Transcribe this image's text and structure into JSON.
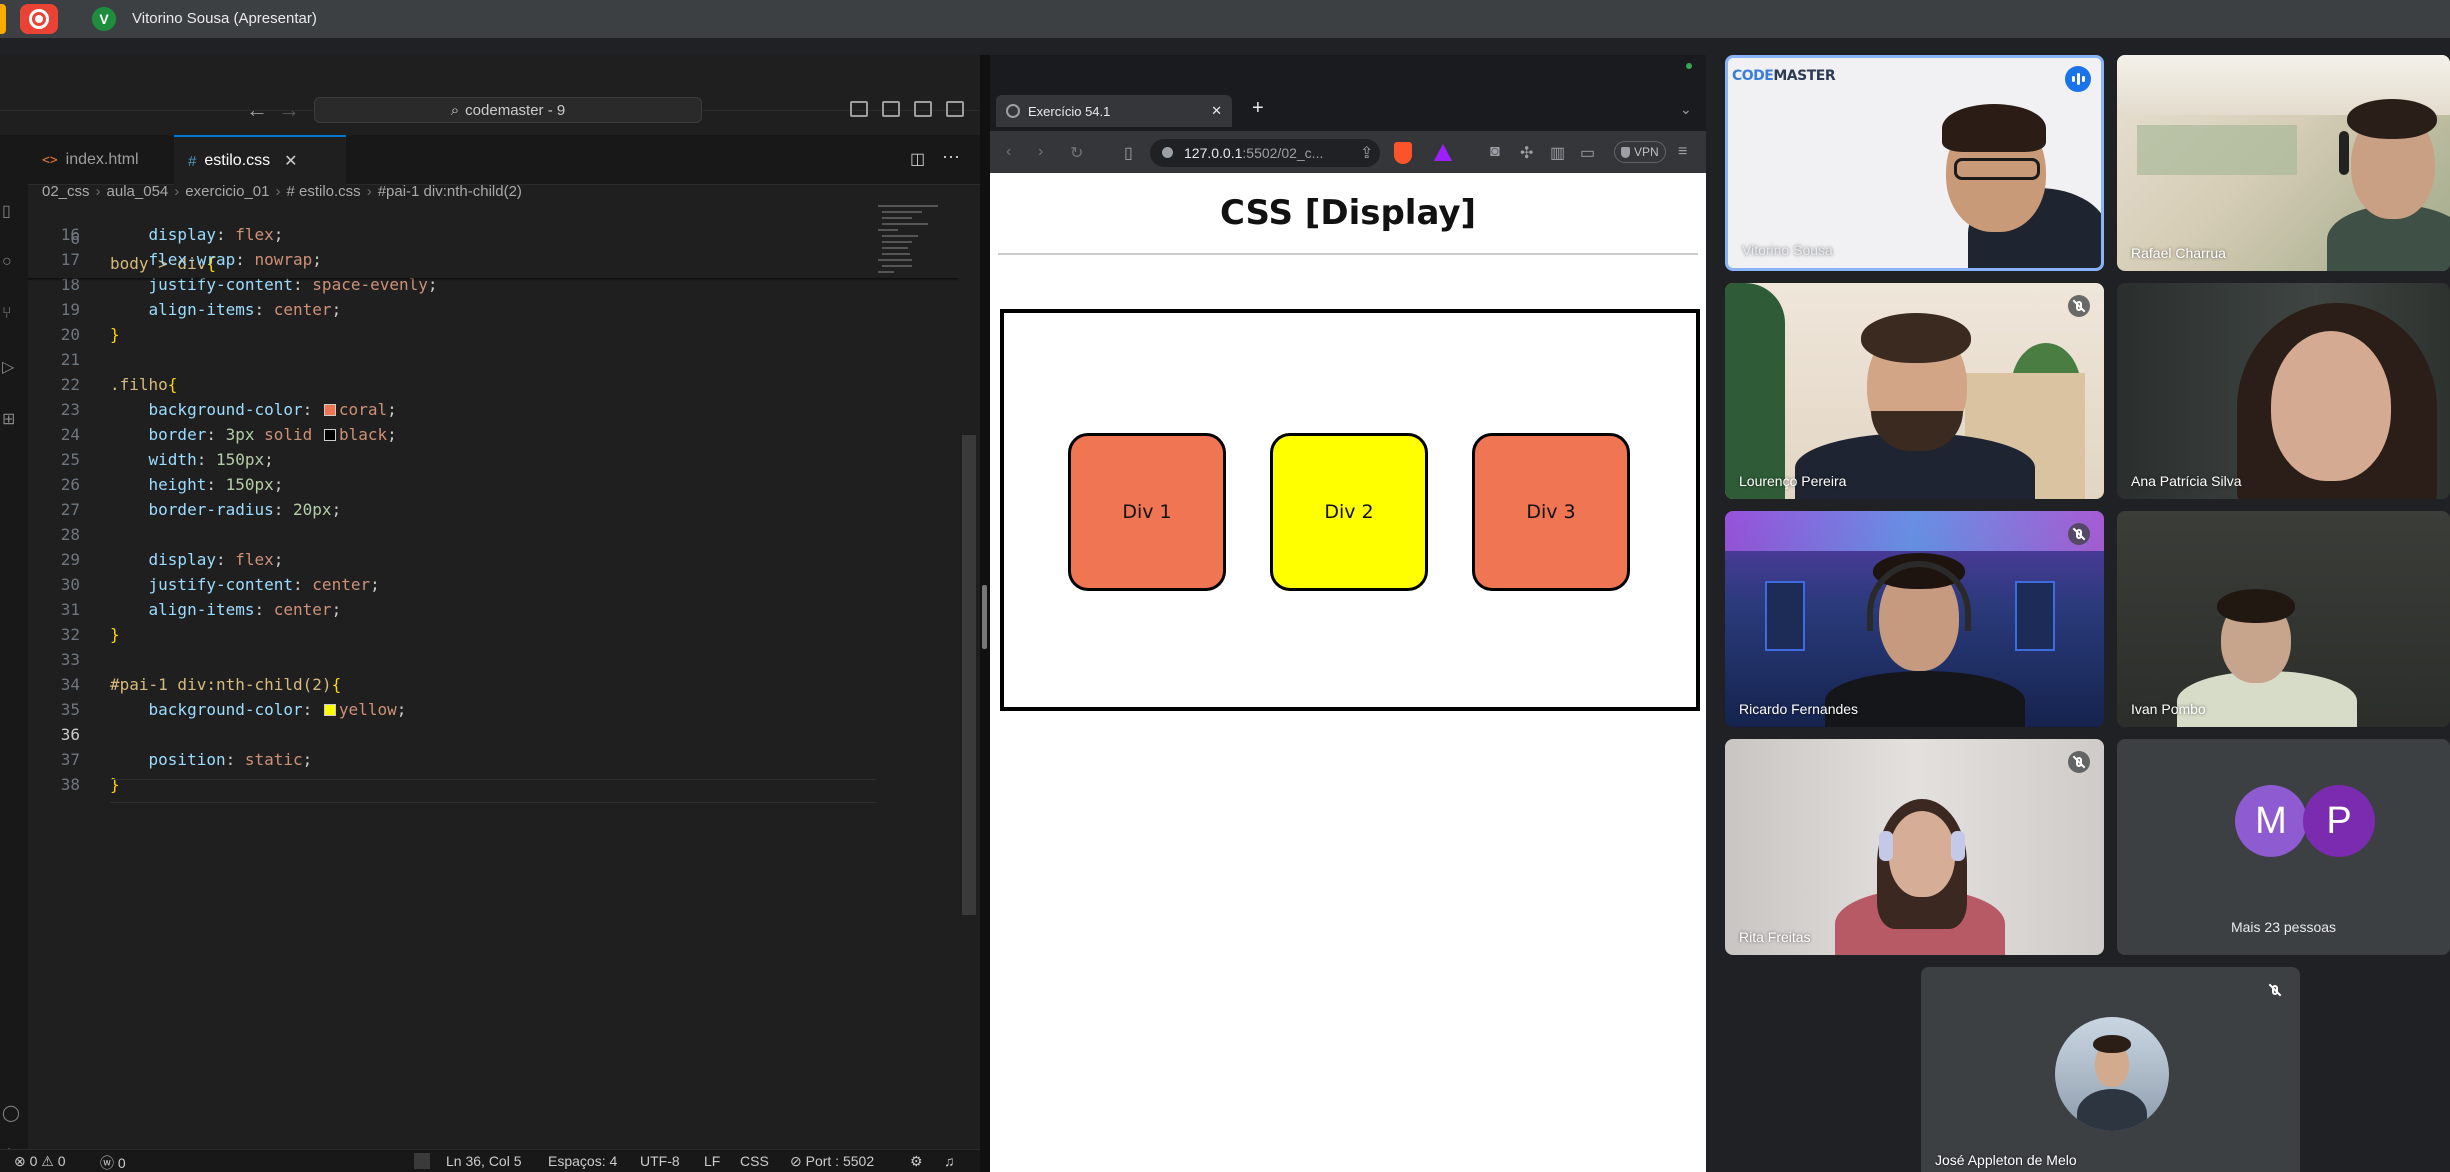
{
  "meet": {
    "presenter_initial": "V",
    "presenter_label": "Vitorino Sousa (Apresentar)",
    "participants": [
      {
        "name": "Vitorino Sousa",
        "speaking": true
      },
      {
        "name": "Rafael Charrua"
      },
      {
        "name": "Lourenço Pereira",
        "muted": true
      },
      {
        "name": "Ana Patrícia Silva"
      },
      {
        "name": "Ricardo Fernandes",
        "muted": true
      },
      {
        "name": "Ivan Pombo"
      },
      {
        "name": "Rita Freitas",
        "muted": true
      },
      {
        "name": "José Appleton de Melo",
        "muted": true
      }
    ],
    "more": {
      "avatars": [
        "M",
        "P"
      ],
      "label": "Mais 23 pessoas"
    },
    "logo": {
      "part1": "CODE",
      "part2": "MASTER"
    }
  },
  "vscode": {
    "command_center": "codemaster - 9",
    "tabs": [
      {
        "icon": "<>",
        "label": "index.html",
        "active": false
      },
      {
        "icon": "#",
        "label": "estilo.css",
        "active": true
      }
    ],
    "breadcrumb": [
      "02_css",
      "aula_054",
      "exercicio_01",
      "# estilo.css",
      "#pai-1 div:nth-child(2)"
    ],
    "sticky_line": {
      "num": "6",
      "text": "body > div{"
    },
    "lines": [
      {
        "num": "16",
        "text": "    display: flex;"
      },
      {
        "num": "17",
        "text": "    flex-wrap: nowrap;"
      },
      {
        "num": "18",
        "text": "    justify-content: space-evenly;"
      },
      {
        "num": "19",
        "text": "    align-items: center;"
      },
      {
        "num": "20",
        "text": "}"
      },
      {
        "num": "21",
        "text": ""
      },
      {
        "num": "22",
        "text": ".filho{"
      },
      {
        "num": "23",
        "text": "    background-color: coral;"
      },
      {
        "num": "24",
        "text": "    border: 3px solid black;"
      },
      {
        "num": "25",
        "text": "    width: 150px;"
      },
      {
        "num": "26",
        "text": "    height: 150px;"
      },
      {
        "num": "27",
        "text": "    border-radius: 20px;"
      },
      {
        "num": "28",
        "text": ""
      },
      {
        "num": "29",
        "text": "    display: flex;"
      },
      {
        "num": "30",
        "text": "    justify-content: center;"
      },
      {
        "num": "31",
        "text": "    align-items: center;"
      },
      {
        "num": "32",
        "text": "}"
      },
      {
        "num": "33",
        "text": ""
      },
      {
        "num": "34",
        "text": "#pai-1 div:nth-child(2){"
      },
      {
        "num": "35",
        "text": "    background-color: yellow;"
      },
      {
        "num": "36",
        "text": ""
      },
      {
        "num": "37",
        "text": "    position: static;"
      },
      {
        "num": "38",
        "text": "}"
      }
    ],
    "status": {
      "problems": "⊗ 0 ⚠ 0",
      "ports": "ⓦ 0",
      "position": "Ln 36, Col 5",
      "spaces": "Espaços: 4",
      "encoding": "UTF-8",
      "eol": "LF",
      "language": "CSS",
      "port": "⊘ Port : 5502"
    }
  },
  "browser": {
    "tab_title": "Exercício 54.1",
    "url_host": "127.0.0.1",
    "url_rest": ":5502/02_c...",
    "vpn_label": "VPN",
    "page": {
      "title": "CSS [Display]",
      "boxes": [
        {
          "label": "Div 1",
          "color": "#f07552"
        },
        {
          "label": "Div 2",
          "color": "#ffff00"
        },
        {
          "label": "Div 3",
          "color": "#f07552"
        }
      ]
    }
  },
  "colors": {
    "coral": "#f07552",
    "yellow": "#ffff00",
    "accent": "#8ab4f8",
    "record": "#ea4335"
  }
}
